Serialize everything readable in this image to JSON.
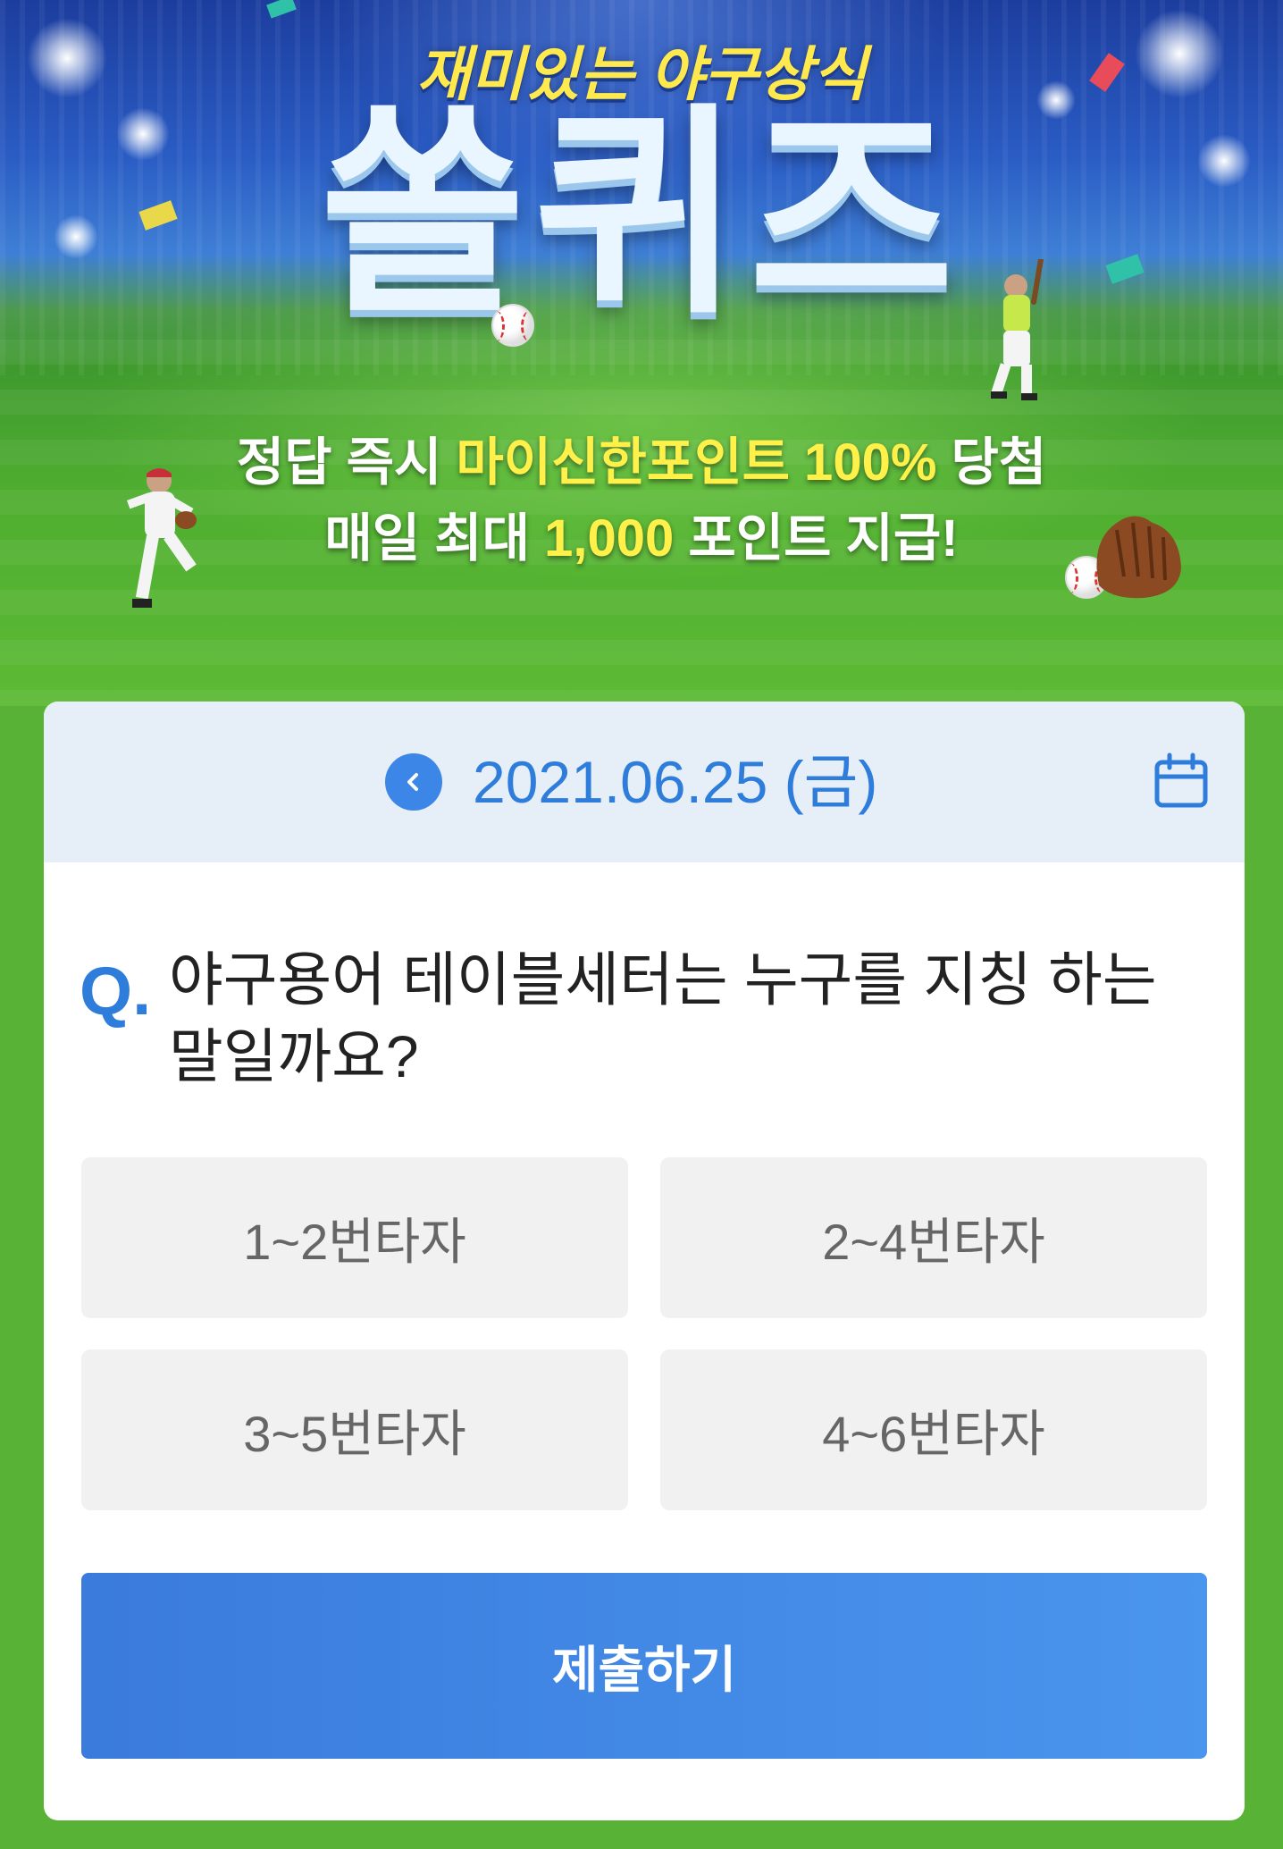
{
  "hero": {
    "subtitle": "재미있는 야구상식",
    "title": "쏠퀴즈",
    "line1_a": "정답 즉시 ",
    "line1_hl": "마이신한포인트 100%",
    "line1_b": " 당첨",
    "line2_a": "매일 최대 ",
    "line2_hl": "1,000",
    "line2_b": " 포인트 지급!",
    "colors": {
      "highlight": "#fff04a",
      "subtitle": "#ffe94d",
      "grass": "#58b236"
    }
  },
  "date_bar": {
    "date": "2021.06.25 (금)",
    "prev_icon": "chevron-left-icon",
    "calendar_icon": "calendar-icon"
  },
  "question": {
    "mark": "Q.",
    "text": "야구용어 테이블세터는 누구를 지칭 하는 말일까요?"
  },
  "options": [
    {
      "label": "1~2번타자"
    },
    {
      "label": "2~4번타자"
    },
    {
      "label": "3~5번타자"
    },
    {
      "label": "4~6번타자"
    }
  ],
  "submit": {
    "label": "제출하기"
  },
  "theme": {
    "accent": "#2f7ddb",
    "button": "#3a7bdc",
    "option_bg": "#f1f1f1"
  }
}
